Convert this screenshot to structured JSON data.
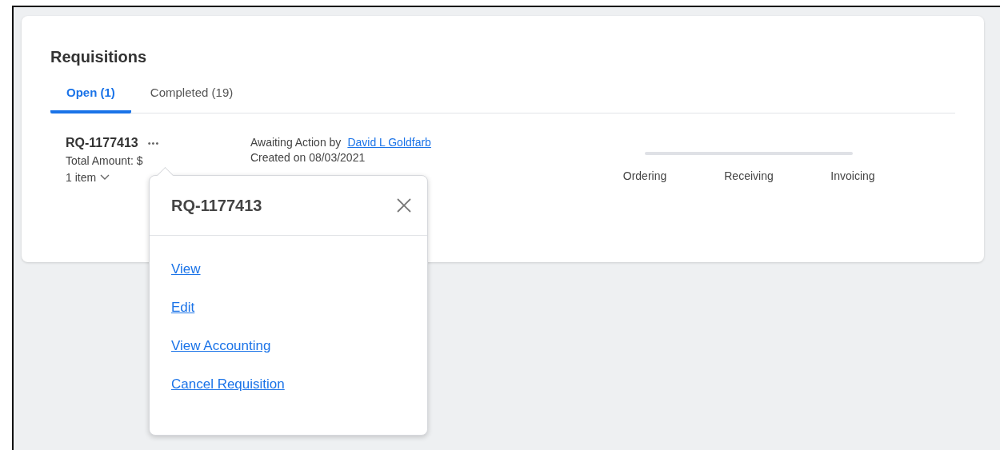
{
  "panel": {
    "title": "Requisitions",
    "tabs": [
      {
        "label": "Open (1)",
        "selected": true
      },
      {
        "label": "Completed (19)",
        "selected": false
      }
    ],
    "requisitions": [
      {
        "number": "RQ-1177413",
        "more": "•••",
        "amount": "Total Amount: $",
        "items": "1 item",
        "status": "Awaiting Action by",
        "assignee": "David L Goldfarb",
        "created": "Created on 08/03/2021",
        "stages": [
          {
            "label": "Ordering"
          },
          {
            "label": "Receiving"
          },
          {
            "label": "Invoicing"
          }
        ]
      }
    ]
  },
  "popover": {
    "title": "RQ-1177413",
    "actions": [
      "View",
      "Edit",
      "View Accounting",
      "Cancel Requisition"
    ]
  }
}
